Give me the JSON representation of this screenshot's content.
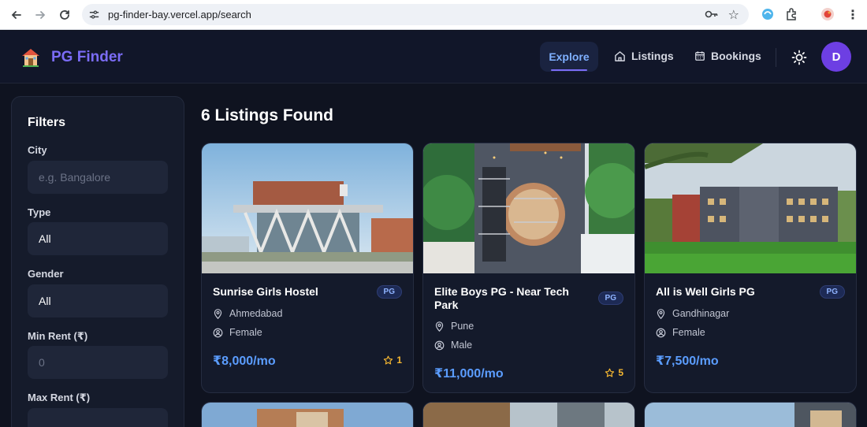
{
  "browser": {
    "url": "pg-finder-bay.vercel.app/search"
  },
  "header": {
    "brand": "PG Finder",
    "nav": {
      "explore": "Explore",
      "listings": "Listings",
      "bookings": "Bookings"
    },
    "avatar_initial": "D"
  },
  "filters": {
    "title": "Filters",
    "city_label": "City",
    "city_placeholder": "e.g. Bangalore",
    "type_label": "Type",
    "type_value": "All",
    "gender_label": "Gender",
    "gender_value": "All",
    "min_rent_label": "Min Rent (₹)",
    "min_rent_placeholder": "0",
    "max_rent_label": "Max Rent (₹)"
  },
  "results": {
    "title": "6 Listings Found",
    "cards": [
      {
        "name": "Sunrise Girls Hostel",
        "type": "PG",
        "city": "Ahmedabad",
        "gender": "Female",
        "price": "₹8,000/mo",
        "rating": "1"
      },
      {
        "name": "Elite Boys PG - Near Tech Park",
        "type": "PG",
        "city": "Pune",
        "gender": "Male",
        "price": "₹11,000/mo",
        "rating": "5"
      },
      {
        "name": "All is Well Girls PG",
        "type": "PG",
        "city": "Gandhinagar",
        "gender": "Female",
        "price": "₹7,500/mo",
        "rating": ""
      }
    ]
  },
  "colors": {
    "accent": "#7b6cf6",
    "price": "#5b9dff",
    "star": "#f5b731",
    "background": "#0f1320"
  }
}
